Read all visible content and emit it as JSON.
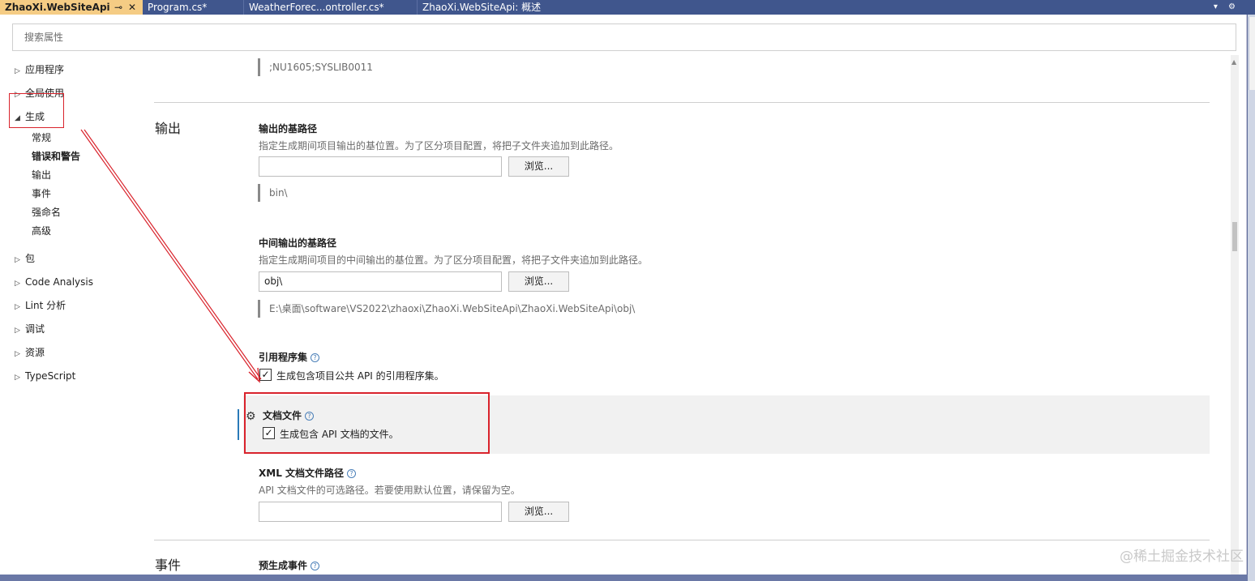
{
  "tabs": [
    {
      "label": "ZhaoXi.WebSiteApi",
      "active": true
    },
    {
      "label": "Program.cs*",
      "active": false
    },
    {
      "label": "WeatherForec...ontroller.cs*",
      "active": false
    },
    {
      "label": "ZhaoXi.WebSiteApi: 概述",
      "active": false
    }
  ],
  "tab_icons": {
    "pin": "⊸",
    "close": "✕",
    "dropdown": "▾",
    "settings": "⚙"
  },
  "search": {
    "placeholder": "搜索属性"
  },
  "nav": {
    "items": [
      {
        "label": "应用程序",
        "expanded": false
      },
      {
        "label": "全局使用",
        "expanded": false
      },
      {
        "label": "生成",
        "expanded": true
      },
      {
        "label": "包",
        "expanded": false
      },
      {
        "label": "Code Analysis",
        "expanded": false
      },
      {
        "label": "Lint 分析",
        "expanded": false
      },
      {
        "label": "调试",
        "expanded": false
      },
      {
        "label": "资源",
        "expanded": false
      },
      {
        "label": "TypeScript",
        "expanded": false
      }
    ],
    "build_subitems": [
      "常规",
      "错误和警告",
      "输出",
      "事件",
      "强命名",
      "高级"
    ],
    "selected_subitem": "错误和警告"
  },
  "content": {
    "top_value": ";NU1605;SYSLIB0011",
    "output_section_title": "输出",
    "base_output": {
      "label": "输出的基路径",
      "description": "指定生成期间项目输出的基位置。为了区分项目配置，将把子文件夹追加到此路径。",
      "value": "",
      "browse": "浏览...",
      "resolved": "bin\\"
    },
    "intermediate_output": {
      "label": "中间输出的基路径",
      "description": "指定生成期间项目的中间输出的基位置。为了区分项目配置，将把子文件夹追加到此路径。",
      "value": "obj\\",
      "browse": "浏览...",
      "resolved": "E:\\桌面\\software\\VS2022\\zhaoxi\\ZhaoXi.WebSiteApi\\ZhaoXi.WebSiteApi\\obj\\"
    },
    "reference_assembly": {
      "label": "引用程序集",
      "checkbox_label": "生成包含项目公共 API 的引用程序集。",
      "checked": true
    },
    "documentation_file": {
      "label": "文档文件",
      "checkbox_label": "生成包含 API 文档的文件。",
      "checked": true
    },
    "xml_doc_path": {
      "label": "XML 文档文件路径",
      "description": "API 文档文件的可选路径。若要使用默认位置，请保留为空。",
      "value": "",
      "browse": "浏览..."
    },
    "events_section_title": "事件",
    "pre_build_event": {
      "label": "预生成事件"
    }
  },
  "watermark": "@稀土掘金技术社区",
  "colors": {
    "tab_active": "#f5cc84",
    "tabbar": "#40568d",
    "annotation_red": "#d9232c",
    "accent": "#2a7ab8"
  }
}
